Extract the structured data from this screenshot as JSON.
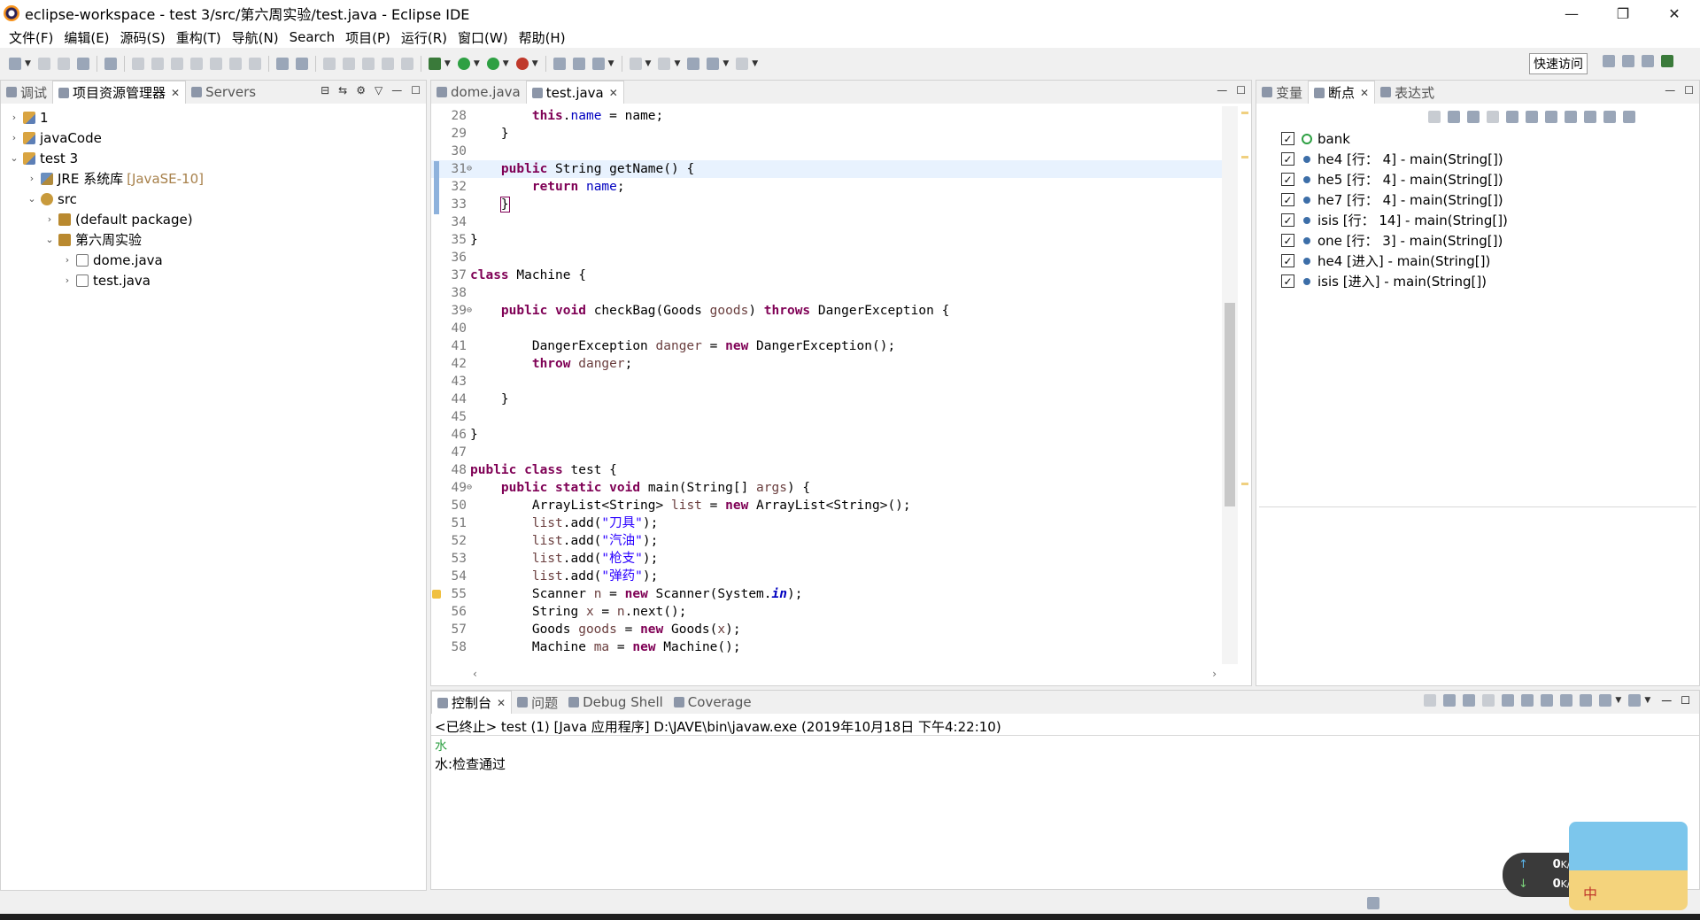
{
  "window": {
    "title": "eclipse-workspace - test 3/src/第六周实验/test.java - Eclipse IDE",
    "controls": {
      "minimize": "—",
      "restore": "❐",
      "close": "✕"
    }
  },
  "menu": [
    "文件(F)",
    "编辑(E)",
    "源码(S)",
    "重构(T)",
    "导航(N)",
    "Search",
    "项目(P)",
    "运行(R)",
    "窗口(W)",
    "帮助(H)"
  ],
  "toolbar": {
    "quick_access": "快速访问"
  },
  "explorer": {
    "tabs": [
      {
        "label": "调试",
        "active": false
      },
      {
        "label": "项目资源管理器",
        "active": true,
        "close": "✕"
      },
      {
        "label": "Servers",
        "active": false
      }
    ],
    "tree": [
      {
        "chev": "›",
        "indent": 0,
        "icon": "project-icon",
        "label": "1"
      },
      {
        "chev": "›",
        "indent": 0,
        "icon": "project-icon",
        "label": "javaCode"
      },
      {
        "chev": "⌄",
        "indent": 0,
        "icon": "project-icon",
        "label": "test 3"
      },
      {
        "chev": "›",
        "indent": 1,
        "icon": "library-icon",
        "label": "JRE 系统库",
        "suffix": "[JavaSE-10]"
      },
      {
        "chev": "⌄",
        "indent": 1,
        "icon": "source-folder-icon",
        "label": "src"
      },
      {
        "chev": "›",
        "indent": 2,
        "icon": "package-icon",
        "label": "(default package)"
      },
      {
        "chev": "⌄",
        "indent": 2,
        "icon": "package-icon",
        "label": "第六周实验"
      },
      {
        "chev": "›",
        "indent": 3,
        "icon": "java-file-icon",
        "label": "dome.java"
      },
      {
        "chev": "›",
        "indent": 3,
        "icon": "java-file-icon",
        "label": "test.java"
      }
    ]
  },
  "editor": {
    "tabs": [
      {
        "label": "dome.java",
        "active": false
      },
      {
        "label": "test.java",
        "active": true,
        "close": "✕"
      }
    ],
    "current_line": 31,
    "lines": [
      {
        "n": "28",
        "fold": "",
        "tokens": [
          [
            "",
            "        "
          ],
          [
            "kw",
            "this"
          ],
          [
            "",
            "."
          ],
          [
            "fld",
            "name"
          ],
          [
            "",
            " = name;"
          ]
        ]
      },
      {
        "n": "29",
        "fold": "",
        "tokens": [
          [
            "",
            "    }"
          ]
        ]
      },
      {
        "n": "30",
        "fold": "",
        "tokens": []
      },
      {
        "n": "31",
        "fold": "⊖",
        "tokens": [
          [
            "",
            "    "
          ],
          [
            "kw",
            "public"
          ],
          [
            "",
            " String getName() {"
          ]
        ]
      },
      {
        "n": "32",
        "fold": "",
        "tokens": [
          [
            "",
            "        "
          ],
          [
            "kw",
            "return"
          ],
          [
            "",
            " "
          ],
          [
            "fld",
            "name"
          ],
          [
            "",
            ";"
          ]
        ]
      },
      {
        "n": "33",
        "fold": "",
        "tokens": [
          [
            "",
            "    "
          ],
          [
            "box",
            "}"
          ]
        ]
      },
      {
        "n": "34",
        "fold": "",
        "tokens": []
      },
      {
        "n": "35",
        "fold": "",
        "tokens": [
          [
            "",
            "}"
          ]
        ]
      },
      {
        "n": "36",
        "fold": "",
        "tokens": []
      },
      {
        "n": "37",
        "fold": "",
        "tokens": [
          [
            "kw",
            "class"
          ],
          [
            "",
            " Machine {"
          ]
        ]
      },
      {
        "n": "38",
        "fold": "",
        "tokens": []
      },
      {
        "n": "39",
        "fold": "⊖",
        "tokens": [
          [
            "",
            "    "
          ],
          [
            "kw",
            "public"
          ],
          [
            "",
            " "
          ],
          [
            "kw",
            "void"
          ],
          [
            "",
            " checkBag(Goods "
          ],
          [
            "var",
            "goods"
          ],
          [
            "",
            ") "
          ],
          [
            "kw",
            "throws"
          ],
          [
            "",
            " DangerException {"
          ]
        ]
      },
      {
        "n": "40",
        "fold": "",
        "tokens": []
      },
      {
        "n": "41",
        "fold": "",
        "tokens": [
          [
            "",
            "        DangerException "
          ],
          [
            "var",
            "danger"
          ],
          [
            "",
            " = "
          ],
          [
            "kw",
            "new"
          ],
          [
            "",
            " DangerException();"
          ]
        ]
      },
      {
        "n": "42",
        "fold": "",
        "tokens": [
          [
            "",
            "        "
          ],
          [
            "kw",
            "throw"
          ],
          [
            "",
            " "
          ],
          [
            "var",
            "danger"
          ],
          [
            "",
            ";"
          ]
        ]
      },
      {
        "n": "43",
        "fold": "",
        "tokens": []
      },
      {
        "n": "44",
        "fold": "",
        "tokens": [
          [
            "",
            "    }"
          ]
        ]
      },
      {
        "n": "45",
        "fold": "",
        "tokens": []
      },
      {
        "n": "46",
        "fold": "",
        "tokens": [
          [
            "",
            "}"
          ]
        ]
      },
      {
        "n": "47",
        "fold": "",
        "tokens": []
      },
      {
        "n": "48",
        "fold": "",
        "tokens": [
          [
            "kw",
            "public"
          ],
          [
            "",
            " "
          ],
          [
            "kw",
            "class"
          ],
          [
            "",
            " test {"
          ]
        ]
      },
      {
        "n": "49",
        "fold": "⊖",
        "tokens": [
          [
            "",
            "    "
          ],
          [
            "kw",
            "public"
          ],
          [
            "",
            " "
          ],
          [
            "kw",
            "static"
          ],
          [
            "",
            " "
          ],
          [
            "kw",
            "void"
          ],
          [
            "",
            " main(String[] "
          ],
          [
            "var",
            "args"
          ],
          [
            "",
            ") {"
          ]
        ]
      },
      {
        "n": "50",
        "fold": "",
        "tokens": [
          [
            "",
            "        ArrayList<String> "
          ],
          [
            "var",
            "list"
          ],
          [
            "",
            " = "
          ],
          [
            "kw",
            "new"
          ],
          [
            "",
            " ArrayList<String>();"
          ]
        ]
      },
      {
        "n": "51",
        "fold": "",
        "tokens": [
          [
            "",
            "        "
          ],
          [
            "var",
            "list"
          ],
          [
            "",
            ".add("
          ],
          [
            "str",
            "\"刀具\""
          ],
          [
            "",
            ");"
          ]
        ]
      },
      {
        "n": "52",
        "fold": "",
        "tokens": [
          [
            "",
            "        "
          ],
          [
            "var",
            "list"
          ],
          [
            "",
            ".add("
          ],
          [
            "str",
            "\"汽油\""
          ],
          [
            "",
            ");"
          ]
        ]
      },
      {
        "n": "53",
        "fold": "",
        "tokens": [
          [
            "",
            "        "
          ],
          [
            "var",
            "list"
          ],
          [
            "",
            ".add("
          ],
          [
            "str",
            "\"枪支\""
          ],
          [
            "",
            ");"
          ]
        ]
      },
      {
        "n": "54",
        "fold": "",
        "tokens": [
          [
            "",
            "        "
          ],
          [
            "var",
            "list"
          ],
          [
            "",
            ".add("
          ],
          [
            "str",
            "\"弹药\""
          ],
          [
            "",
            ");"
          ]
        ]
      },
      {
        "n": "55",
        "fold": "",
        "tokens": [
          [
            "",
            "        Scanner "
          ],
          [
            "var",
            "n"
          ],
          [
            "",
            " = "
          ],
          [
            "kw",
            "new"
          ],
          [
            "",
            " Scanner(System."
          ],
          [
            "st",
            "in"
          ],
          [
            "",
            ");"
          ]
        ]
      },
      {
        "n": "56",
        "fold": "",
        "tokens": [
          [
            "",
            "        String "
          ],
          [
            "var",
            "x"
          ],
          [
            "",
            " = "
          ],
          [
            "var",
            "n"
          ],
          [
            "",
            ".next();"
          ]
        ]
      },
      {
        "n": "57",
        "fold": "",
        "tokens": [
          [
            "",
            "        Goods "
          ],
          [
            "var",
            "goods"
          ],
          [
            "",
            " = "
          ],
          [
            "kw",
            "new"
          ],
          [
            "",
            " Goods("
          ],
          [
            "var",
            "x"
          ],
          [
            "",
            ");"
          ]
        ]
      },
      {
        "n": "58",
        "fold": "",
        "tokens": [
          [
            "",
            "        Machine "
          ],
          [
            "var",
            "ma"
          ],
          [
            "",
            " = "
          ],
          [
            "kw",
            "new"
          ],
          [
            "",
            " Machine();"
          ]
        ]
      }
    ]
  },
  "debug_panel": {
    "tabs": [
      {
        "label": "变量",
        "active": false
      },
      {
        "label": "断点",
        "active": true,
        "close": "✕"
      },
      {
        "label": "表达式",
        "active": false
      }
    ],
    "breakpoints": [
      {
        "checked": "✓",
        "kind": "exception",
        "label": "bank"
      },
      {
        "checked": "✓",
        "kind": "line",
        "label": "he4 [行：  4] - main(String[])"
      },
      {
        "checked": "✓",
        "kind": "line",
        "label": "he5 [行：  4] - main(String[])"
      },
      {
        "checked": "✓",
        "kind": "line",
        "label": "he7 [行：  4] - main(String[])"
      },
      {
        "checked": "✓",
        "kind": "line",
        "label": "isis [行：  14] - main(String[])"
      },
      {
        "checked": "✓",
        "kind": "line",
        "label": "one [行：  3] - main(String[])"
      },
      {
        "checked": "✓",
        "kind": "method",
        "label": "he4 [进入] - main(String[])"
      },
      {
        "checked": "✓",
        "kind": "method",
        "label": "isis [进入] - main(String[])"
      }
    ]
  },
  "console": {
    "tabs": [
      {
        "label": "控制台",
        "active": true,
        "close": "✕"
      },
      {
        "label": "问题",
        "active": false
      },
      {
        "label": "Debug Shell",
        "active": false
      },
      {
        "label": "Coverage",
        "active": false
      }
    ],
    "status": "<已终止> test (1)  [Java 应用程序] D:\\JAVE\\bin\\javaw.exe (2019年10月18日 下午4:22:10)",
    "input_echo": "水",
    "output": "水:检查通过"
  },
  "net_widget": {
    "up": "0",
    "down": "0",
    "unit": "K/s"
  },
  "ime": {
    "label": "中"
  },
  "colors": {
    "keyword": "#7f0055",
    "field": "#0000c0",
    "string": "#2a00ff",
    "local_var": "#6a3e3e",
    "console_input": "#2ea043"
  }
}
